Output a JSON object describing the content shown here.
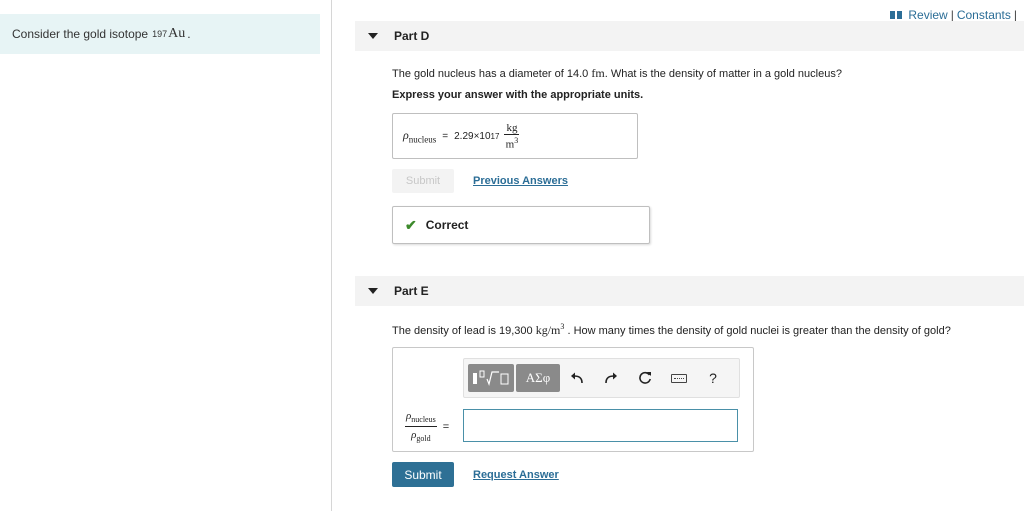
{
  "left": {
    "prefix": "Consider the gold isotope",
    "mass_number": "197",
    "symbol": "Au",
    "suffix": "."
  },
  "header_links": {
    "review": "Review",
    "sep": "|",
    "constants": "Constants",
    "trailing_sep": "|"
  },
  "part_d": {
    "title": "Part D",
    "question_prefix": "The gold nucleus has a diameter of 14.0",
    "question_unit": "fm",
    "question_suffix": ". What is the density of matter in a gold nucleus?",
    "instruction": "Express your answer with the appropriate units.",
    "answer": {
      "symbol": "ρ",
      "subscript": "nucleus",
      "equals": "=",
      "mantissa": "2.29×10",
      "exponent": "17",
      "unit_num": "kg",
      "unit_den": "m",
      "unit_den_exp": "3"
    },
    "submit_label": "Submit",
    "previous_answers_label": "Previous Answers",
    "feedback": "Correct"
  },
  "part_e": {
    "title": "Part E",
    "question_prefix": "The density of lead is 19,300",
    "question_unit": "kg/m",
    "question_unit_exp": "3",
    "question_suffix": ". How many times the density of gold nuclei is greater than the density of gold?",
    "lhs": {
      "num_symbol": "ρ",
      "num_sub": "nucleus",
      "den_symbol": "ρ",
      "den_sub": "gold",
      "equals": "="
    },
    "toolbar": {
      "greek_label": "ΑΣφ",
      "help_label": "?"
    },
    "answer_value": "",
    "submit_label": "Submit",
    "request_answer_label": "Request Answer"
  },
  "colors": {
    "link": "#2b6d96",
    "submit_bg": "#2e7095",
    "correct": "#3d8a2c",
    "left_panel_bg": "#e7f4f5"
  }
}
